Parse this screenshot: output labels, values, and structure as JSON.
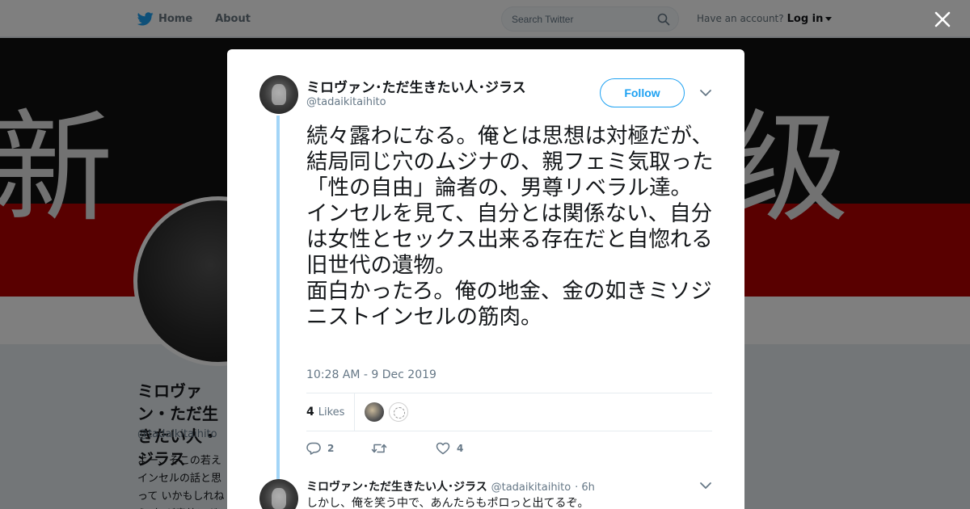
{
  "nav": {
    "home_label": "Home",
    "about_label": "About",
    "search_placeholder": "Search Twitter",
    "account_prompt": "Have an account?",
    "login_label": "Log in"
  },
  "banner": {
    "left_glyph": "新",
    "right_glyph": "级"
  },
  "profile": {
    "name": "ミロヴァン・ただ生きたい人・ジラス",
    "handle": "@tadaikitaihito",
    "bio": "よー、そこの若え インセルの話と思って いかもしれねえ 支 が意外にガルガル"
  },
  "tweet": {
    "author_name": "ミロヴァン･ただ生きたい人･ジラス",
    "author_handle": "@tadaikitaihito",
    "follow_label": "Follow",
    "text": "続々露わになる。俺とは思想は対極だが、結局同じ穴のムジナの、親フェミ気取った「性の自由」論者の、男尊リベラル達。\nインセルを見て、自分とは関係ない、自分は女性とセックス出来る存在だと自惚れる旧世代の遺物。\n面白かったろ。俺の地金、金の如きミソジニストインセルの筋肉。",
    "timestamp": "10:28 AM - 9 Dec 2019",
    "likes_count": "4",
    "likes_label": "Likes",
    "reply_count": "2",
    "like_action_count": "4"
  },
  "reply": {
    "author_name": "ミロヴァン･ただ生きたい人･ジラス",
    "author_handle": "@tadaikitaihito",
    "age": "· 6h",
    "text": "しかし、俺を笑う中で、あんたらもポロっと出てるぞ。"
  },
  "colors": {
    "brand_blue": "#1da1f2",
    "thread_line": "#a3d5f7",
    "muted_text": "#657786"
  },
  "icons": [
    "twitter-bird-icon",
    "home-icon",
    "search-icon",
    "close-icon",
    "chevron-down-icon",
    "reply-icon",
    "retweet-icon",
    "heart-icon"
  ]
}
